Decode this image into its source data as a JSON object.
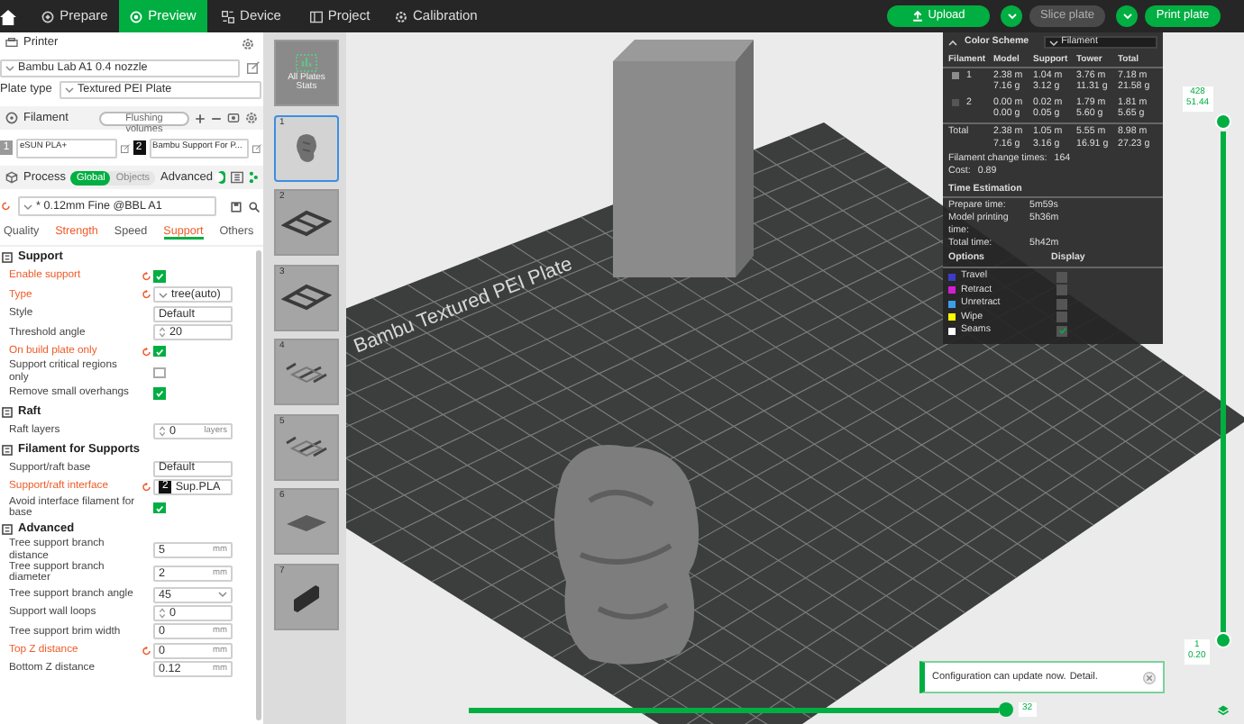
{
  "top_bar": {
    "tabs": [
      {
        "label": "Prepare",
        "selected": false
      },
      {
        "label": "Preview",
        "selected": true
      },
      {
        "label": "Device",
        "selected": false
      },
      {
        "label": "Project",
        "selected": false
      },
      {
        "label": "Calibration",
        "selected": false
      }
    ],
    "buttons": [
      {
        "kind": "upload",
        "label": "Upload",
        "disabled": false
      },
      {
        "kind": "split",
        "label": "Slice plate",
        "disabled": true
      },
      {
        "kind": "split",
        "label": "Print plate",
        "disabled": false
      }
    ]
  },
  "printer": {
    "title": "Printer",
    "preset": "Bambu Lab A1 0.4 nozzle",
    "plate_type_label": "Plate type",
    "plate_type": "Textured PEI Plate"
  },
  "filament": {
    "title": "Filament",
    "flushing_button": "Flushing volumes",
    "items": [
      {
        "index": "1",
        "name": "eSUN PLA+",
        "color": "#9a9a9a"
      },
      {
        "index": "2",
        "name": "Bambu Support For P...",
        "color": "#111111"
      }
    ]
  },
  "process": {
    "title": "Process",
    "scope": [
      {
        "label": "Global",
        "selected": true
      },
      {
        "label": "Objects",
        "selected": false
      }
    ],
    "advanced_label": "Advanced",
    "advanced_on": true,
    "preset": "* 0.12mm Fine @BBL A1",
    "tabs": [
      {
        "label": "Quality",
        "selected": false,
        "modified": false
      },
      {
        "label": "Strength",
        "selected": false,
        "modified": true
      },
      {
        "label": "Speed",
        "selected": false,
        "modified": false
      },
      {
        "label": "Support",
        "selected": true,
        "modified": true
      },
      {
        "label": "Others",
        "selected": false,
        "modified": false
      }
    ]
  },
  "settings": [
    {
      "title": "Support",
      "items": [
        {
          "kind": "checkbox",
          "label": "Enable support",
          "modified": true,
          "checked": true
        },
        {
          "kind": "select",
          "label": "Type",
          "modified": true,
          "value": "tree(auto)"
        },
        {
          "kind": "select",
          "label": "Style",
          "modified": false,
          "value": "Default"
        },
        {
          "kind": "spin",
          "label": "Threshold angle",
          "modified": false,
          "value": "20"
        },
        {
          "kind": "checkbox",
          "label": "On build plate only",
          "modified": true,
          "checked": true
        },
        {
          "kind": "checkbox",
          "label": "Support critical regions only",
          "modified": false,
          "checked": false
        },
        {
          "kind": "checkbox",
          "label": "Remove small overhangs",
          "modified": false,
          "checked": true
        }
      ]
    },
    {
      "title": "Raft",
      "items": [
        {
          "kind": "spin",
          "label": "Raft layers",
          "modified": false,
          "value": "0",
          "unit": "layers"
        }
      ]
    },
    {
      "title": "Filament for Supports",
      "items": [
        {
          "kind": "select",
          "label": "Support/raft base",
          "modified": false,
          "value": "Default"
        },
        {
          "kind": "filament",
          "label": "Support/raft interface",
          "modified": true,
          "badge": "2",
          "value": "Sup.PLA"
        },
        {
          "kind": "checkbox",
          "label": "Avoid interface filament for base",
          "modified": false,
          "checked": true
        }
      ]
    },
    {
      "title": "Advanced",
      "items": [
        {
          "kind": "input",
          "label": "Tree support branch distance",
          "modified": false,
          "value": "5",
          "unit": "mm"
        },
        {
          "kind": "input",
          "label": "Tree support branch diameter",
          "modified": false,
          "value": "2",
          "unit": "mm"
        },
        {
          "kind": "combo",
          "label": "Tree support branch angle",
          "modified": false,
          "value": "45"
        },
        {
          "kind": "spin",
          "label": "Support wall loops",
          "modified": false,
          "value": "0"
        },
        {
          "kind": "input",
          "label": "Tree support brim width",
          "modified": false,
          "value": "0",
          "unit": "mm"
        },
        {
          "kind": "input",
          "label": "Top Z distance",
          "modified": true,
          "value": "0",
          "unit": "mm"
        },
        {
          "kind": "input",
          "label": "Bottom Z distance",
          "modified": false,
          "value": "0.12",
          "unit": "mm"
        }
      ]
    }
  ],
  "plates": [
    {
      "kind": "stats",
      "label": "All Plates Stats",
      "selected": false
    },
    {
      "kind": "figure",
      "label": "1",
      "selected": true
    },
    {
      "kind": "frame",
      "label": "2",
      "selected": false
    },
    {
      "kind": "frame",
      "label": "3",
      "selected": false
    },
    {
      "kind": "flat",
      "label": "4",
      "selected": false
    },
    {
      "kind": "flat",
      "label": "5",
      "selected": false
    },
    {
      "kind": "slab",
      "label": "6",
      "selected": false
    },
    {
      "kind": "block",
      "label": "7",
      "selected": false
    }
  ],
  "viewport": {
    "bed_label": "Bambu Textured PEI Plate"
  },
  "color_scheme": {
    "title": "Color Scheme",
    "mode": "Filament",
    "columns": [
      "Filament",
      "Model",
      "Support",
      "Tower",
      "Total"
    ],
    "filaments": [
      {
        "index": "1",
        "color": "#8c8c8c",
        "cells": [
          [
            "2.38 m",
            "7.16 g"
          ],
          [
            "1.04 m",
            "3.12 g"
          ],
          [
            "3.76 m",
            "11.31 g"
          ],
          [
            "7.18 m",
            "21.58 g"
          ]
        ]
      },
      {
        "index": "2",
        "color": "#555555",
        "cells": [
          [
            "0.00 m",
            "0.00 g"
          ],
          [
            "0.02 m",
            "0.05 g"
          ],
          [
            "1.79 m",
            "5.60 g"
          ],
          [
            "1.81 m",
            "5.65 g"
          ]
        ]
      }
    ],
    "total": {
      "label": "Total",
      "cells": [
        [
          "2.38 m",
          "7.16 g"
        ],
        [
          "1.05 m",
          "3.16 g"
        ],
        [
          "5.55 m",
          "16.91 g"
        ],
        [
          "8.98 m",
          "27.23 g"
        ]
      ]
    },
    "stats": [
      {
        "label": "Filament change times:",
        "value": "164"
      },
      {
        "label": "Cost:",
        "value": "0.89"
      }
    ],
    "time_title": "Time Estimation",
    "times": [
      {
        "label": "Prepare time:",
        "value": "5m59s"
      },
      {
        "label": "Model printing time:",
        "value": "5h36m"
      },
      {
        "label": "Total time:",
        "value": "5h42m"
      }
    ],
    "options_header": "Options",
    "display_header": "Display",
    "options": [
      {
        "label": "Travel",
        "color": "#3c3cc8",
        "checked": false
      },
      {
        "label": "Retract",
        "color": "#d21ed2",
        "checked": false
      },
      {
        "label": "Unretract",
        "color": "#3aa0e6",
        "checked": false
      },
      {
        "label": "Wipe",
        "color": "#ffff00",
        "checked": false
      },
      {
        "label": "Seams",
        "color": "#ffffff",
        "checked": true
      }
    ]
  },
  "layer_slider": {
    "level": 1,
    "top_label": [
      "428",
      "51.44"
    ],
    "bottom_label": [
      "1",
      "0.20"
    ]
  },
  "move_slider": {
    "level": 1,
    "label": "32"
  },
  "notification": {
    "text": "Configuration can update now.",
    "link": "Detail."
  }
}
